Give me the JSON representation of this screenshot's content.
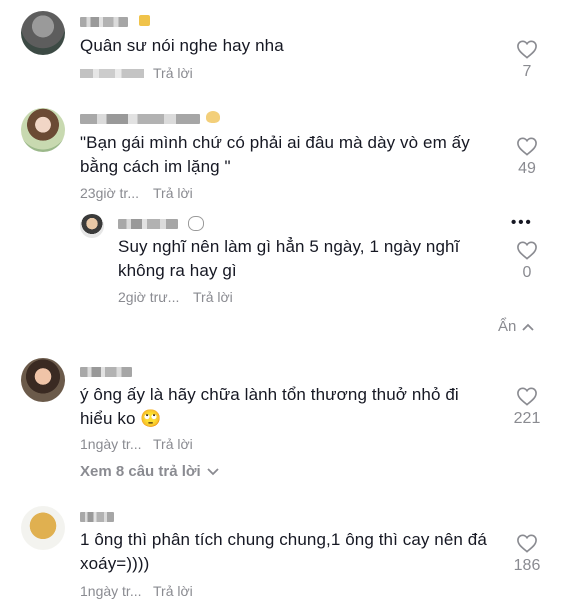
{
  "comments": [
    {
      "text": "Quân sư nói nghe hay nha",
      "reply_label": "Trả lời",
      "likes": "7"
    },
    {
      "text": "\"Bạn gái mình chứ có phải ai đâu mà dày vò em ấy bằng cách im lặng \"",
      "time": "23giờ tr...",
      "reply_label": "Trả lời",
      "likes": "49",
      "reply": {
        "text": "Suy nghĩ nên làm gì hẳn 5 ngày, 1 ngày nghĩ không ra hay gì",
        "time": "2giờ trư...",
        "reply_label": "Trả lời",
        "likes": "0"
      },
      "hide_label": "Ẩn"
    },
    {
      "text": "ý ông ấy là hãy chữa lành tổn thương thuở nhỏ đi hiểu ko 🙄",
      "time": "1ngày tr...",
      "reply_label": "Trả lời",
      "likes": "221",
      "view_replies": "Xem 8 câu trả lời"
    },
    {
      "text": "1 ông thì phân tích chung chung,1 ông thì cay nên đá xoáy=))))",
      "time": "1ngày tr...",
      "reply_label": "Trả lời",
      "likes": "186"
    }
  ],
  "icons": {
    "like": "heart-outline-icon",
    "more": "more-dots-icon",
    "chevron_up": "chevron-up-icon",
    "chevron_down": "chevron-down-icon"
  },
  "colors": {
    "text": "#161823",
    "muted": "#8a8b91"
  }
}
